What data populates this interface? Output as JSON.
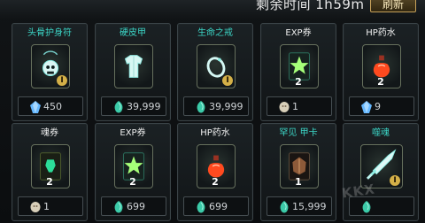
{
  "header": {
    "time_label": "剩余时间 1h59m",
    "refresh_label": "刷新"
  },
  "items": [
    {
      "name": "头骨护身符",
      "icon": "skull-amulet-icon",
      "qty": "",
      "tier": "I",
      "currency": "blue-crystal-icon",
      "price": "450",
      "name_color": "teal"
    },
    {
      "name": "硬皮甲",
      "icon": "leather-armor-icon",
      "qty": "",
      "tier": "",
      "currency": "green-gem-icon",
      "price": "39,999",
      "name_color": "teal"
    },
    {
      "name": "生命之戒",
      "icon": "life-ring-icon",
      "qty": "",
      "tier": "I",
      "currency": "green-gem-icon",
      "price": "39,999",
      "name_color": "teal"
    },
    {
      "name": "EXP券",
      "icon": "exp-ticket-icon",
      "qty": "2",
      "tier": "",
      "currency": "gold-coin-icon",
      "price": "1",
      "name_color": "white"
    },
    {
      "name": "HP药水",
      "icon": "hp-potion-icon",
      "qty": "2",
      "tier": "",
      "currency": "blue-crystal-icon",
      "price": "9",
      "name_color": "white"
    },
    {
      "name": "魂券",
      "icon": "soul-ticket-icon",
      "qty": "2",
      "tier": "",
      "currency": "gold-coin-icon",
      "price": "1",
      "name_color": "white"
    },
    {
      "name": "EXP券",
      "icon": "exp-ticket-icon",
      "qty": "2",
      "tier": "",
      "currency": "green-gem-icon",
      "price": "699",
      "name_color": "white"
    },
    {
      "name": "HP药水",
      "icon": "hp-potion-icon",
      "qty": "2",
      "tier": "",
      "currency": "green-gem-icon",
      "price": "699",
      "name_color": "white"
    },
    {
      "name": "罕见 甲卡",
      "icon": "rare-card-icon",
      "qty": "1",
      "tier": "",
      "currency": "green-gem-icon",
      "price": "15,999",
      "name_color": "teal"
    },
    {
      "name": "噬魂",
      "icon": "soul-sword-icon",
      "qty": "",
      "tier": "I",
      "currency": "green-gem-icon",
      "price": "",
      "name_color": "teal"
    }
  ],
  "watermark": "KKX"
}
